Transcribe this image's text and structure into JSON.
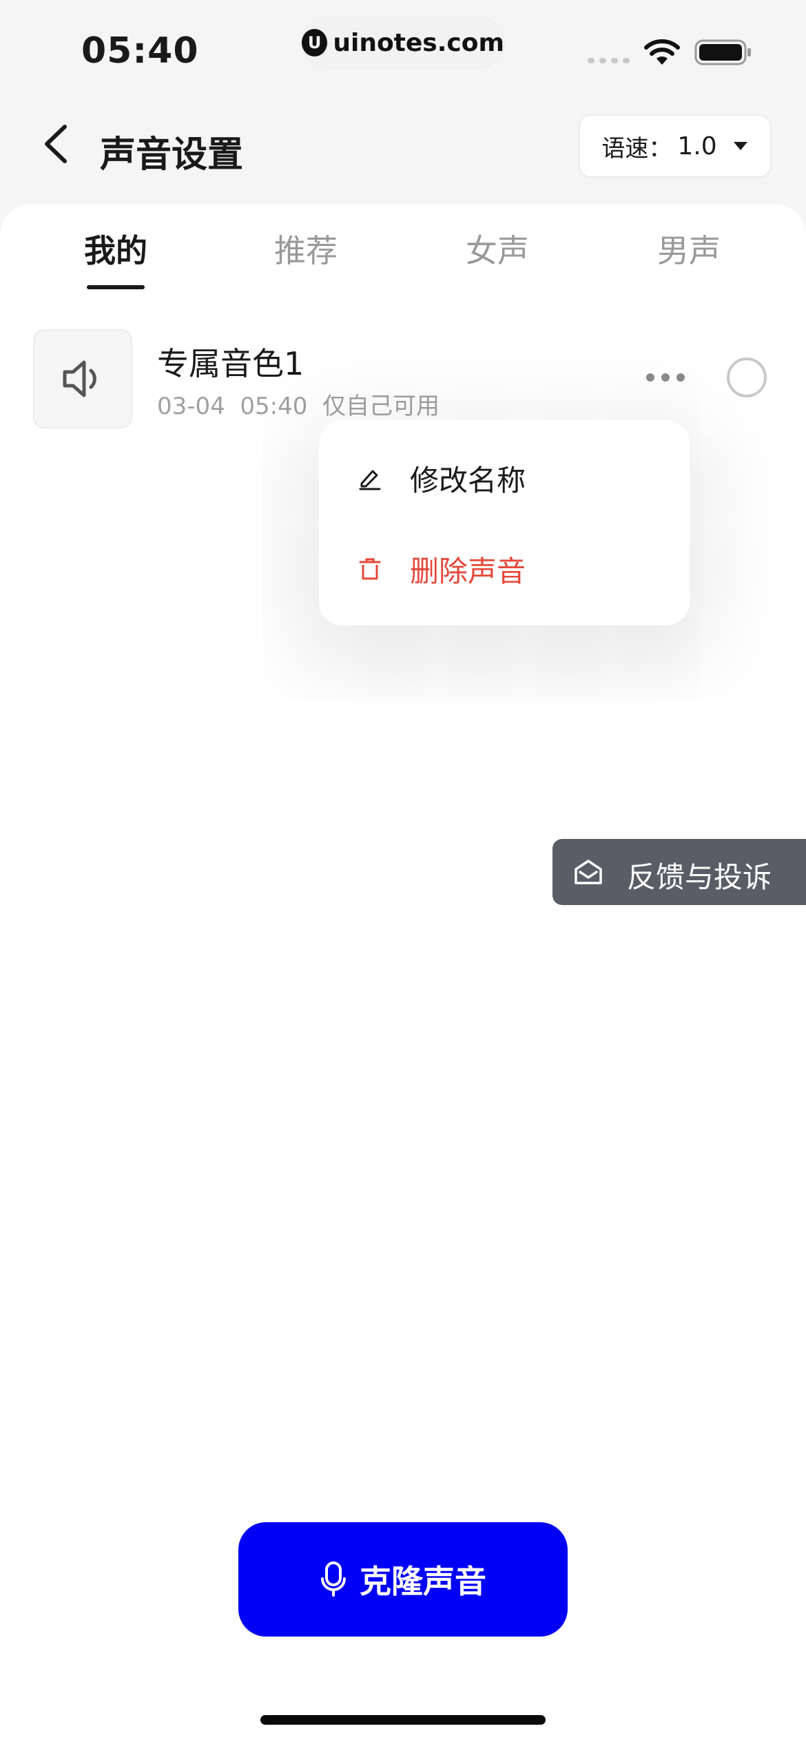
{
  "status_bar": {
    "time": "05:40",
    "site": "uinotes.com",
    "site_logo_letter": "U"
  },
  "header": {
    "title": "声音设置",
    "speed_label": "语速：",
    "speed_value": "1.0"
  },
  "tabs": [
    {
      "label": "我的",
      "active": true
    },
    {
      "label": "推荐",
      "active": false
    },
    {
      "label": "女声",
      "active": false
    },
    {
      "label": "男声",
      "active": false
    }
  ],
  "voice_item": {
    "name": "专属音色1",
    "meta": "03-04  05:40  仅自己可用",
    "icon": "speaker-icon",
    "selected": false
  },
  "menu": {
    "rename_label": "修改名称",
    "delete_label": "删除声音",
    "rename_icon": "pencil-icon",
    "delete_icon": "trash-icon",
    "delete_color": "#e5483a"
  },
  "feedback": {
    "label": "反馈与投诉",
    "icon": "mail-open-icon"
  },
  "clone_button": {
    "label": "克隆声音",
    "icon": "microphone-icon",
    "color": "#0000f5"
  }
}
